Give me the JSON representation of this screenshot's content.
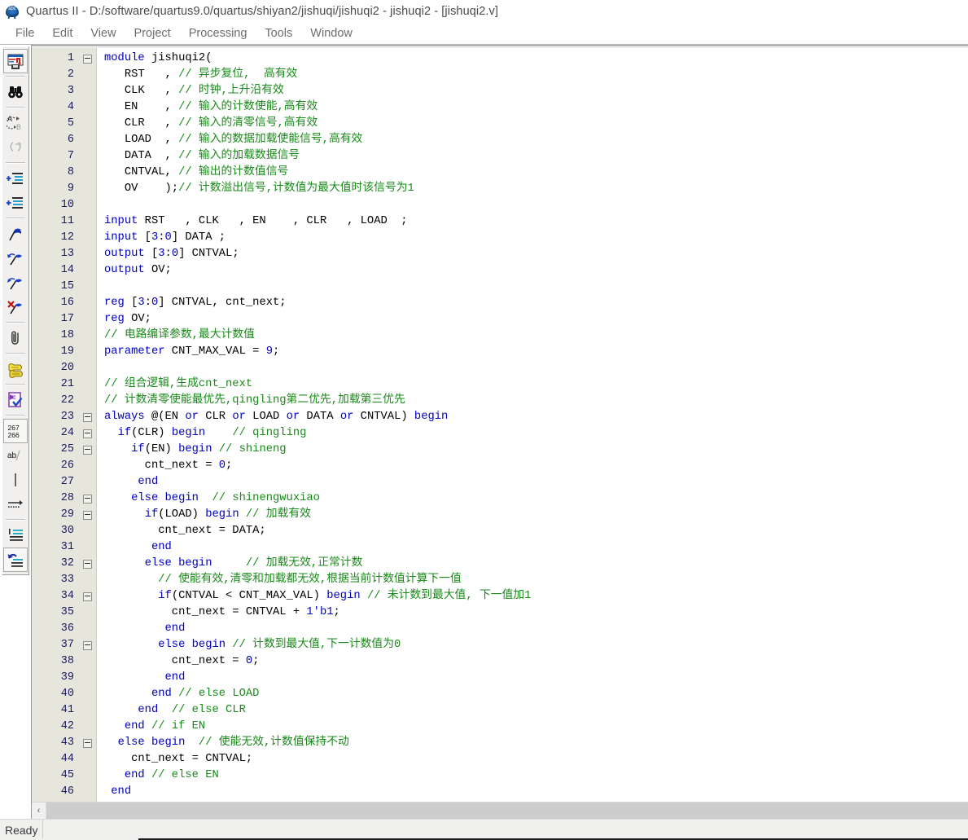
{
  "window": {
    "app_icon": "quartus-abc-icon",
    "title": "Quartus II - D:/software/quartus9.0/quartus/shiyan2/jishuqi/jishuqi2 - jishuqi2 - [jishuqi2.v]"
  },
  "menubar": {
    "items": [
      {
        "label": "File"
      },
      {
        "label": "Edit"
      },
      {
        "label": "View"
      },
      {
        "label": "Project"
      },
      {
        "label": "Processing"
      },
      {
        "label": "Tools"
      },
      {
        "label": "Window"
      }
    ]
  },
  "toolbar": {
    "groups": [
      {
        "buttons": [
          {
            "name": "save-as-icon",
            "selected": true
          }
        ]
      },
      {
        "buttons": [
          {
            "name": "find-binoculars-icon",
            "selected": false
          }
        ]
      },
      {
        "buttons": [
          {
            "name": "replace-a-to-b-icon",
            "selected": false
          },
          {
            "name": "goto-braces-icon",
            "selected": false
          }
        ]
      },
      {
        "buttons": [
          {
            "name": "increase-indent-icon",
            "selected": false
          },
          {
            "name": "decrease-indent-icon",
            "selected": false
          }
        ]
      },
      {
        "buttons": [
          {
            "name": "insert-flag-icon",
            "selected": false
          },
          {
            "name": "next-flag-icon",
            "selected": false
          },
          {
            "name": "previous-flag-icon",
            "selected": false
          },
          {
            "name": "delete-flag-icon",
            "selected": false
          }
        ]
      },
      {
        "buttons": [
          {
            "name": "attach-paperclip-icon",
            "selected": false
          }
        ]
      },
      {
        "buttons": [
          {
            "name": "template-scroll-icon",
            "selected": false
          }
        ]
      },
      {
        "buttons": [
          {
            "name": "check-syntax-icon",
            "selected": false
          }
        ]
      },
      {
        "buttons": [
          {
            "name": "line-numbers-icon",
            "selected": true,
            "label": "267\n266"
          },
          {
            "name": "word-wrap-icon",
            "selected": false,
            "label": "ab/"
          },
          {
            "name": "column-cursor-icon",
            "selected": false
          },
          {
            "name": "show-whitespace-icon",
            "selected": false
          }
        ]
      },
      {
        "buttons": [
          {
            "name": "comment-selection-icon",
            "selected": false
          },
          {
            "name": "uncomment-selection-icon",
            "selected": true
          }
        ]
      }
    ]
  },
  "editor": {
    "file": "jishuqi2.v",
    "first_line": 1,
    "last_line": 46,
    "fold_lines": [
      1,
      23,
      24,
      25,
      28,
      29,
      32,
      34,
      37,
      43
    ],
    "lines": [
      {
        "n": 1,
        "tokens": [
          {
            "t": "kw",
            "s": "module"
          },
          {
            "t": "pln",
            "s": " jishuqi2("
          }
        ]
      },
      {
        "n": 2,
        "tokens": [
          {
            "t": "pln",
            "s": "   RST   , "
          },
          {
            "t": "cmt",
            "s": "// 异步复位,  高有效"
          }
        ]
      },
      {
        "n": 3,
        "tokens": [
          {
            "t": "pln",
            "s": "   CLK   , "
          },
          {
            "t": "cmt",
            "s": "// 时钟,上升沿有效"
          }
        ]
      },
      {
        "n": 4,
        "tokens": [
          {
            "t": "pln",
            "s": "   EN    , "
          },
          {
            "t": "cmt",
            "s": "// 输入的计数使能,高有效"
          }
        ]
      },
      {
        "n": 5,
        "tokens": [
          {
            "t": "pln",
            "s": "   CLR   , "
          },
          {
            "t": "cmt",
            "s": "// 输入的清零信号,高有效"
          }
        ]
      },
      {
        "n": 6,
        "tokens": [
          {
            "t": "pln",
            "s": "   LOAD  , "
          },
          {
            "t": "cmt",
            "s": "// 输入的数据加载使能信号,高有效"
          }
        ]
      },
      {
        "n": 7,
        "tokens": [
          {
            "t": "pln",
            "s": "   DATA  , "
          },
          {
            "t": "cmt",
            "s": "// 输入的加载数据信号"
          }
        ]
      },
      {
        "n": 8,
        "tokens": [
          {
            "t": "pln",
            "s": "   CNTVAL, "
          },
          {
            "t": "cmt",
            "s": "// 输出的计数值信号"
          }
        ]
      },
      {
        "n": 9,
        "tokens": [
          {
            "t": "pln",
            "s": "   OV    );"
          },
          {
            "t": "cmt",
            "s": "// 计数溢出信号,计数值为最大值时该信号为1"
          }
        ]
      },
      {
        "n": 10,
        "tokens": []
      },
      {
        "n": 11,
        "tokens": [
          {
            "t": "kw",
            "s": "input"
          },
          {
            "t": "pln",
            "s": " RST   , CLK   , EN    , CLR   , LOAD  ;"
          }
        ]
      },
      {
        "n": 12,
        "tokens": [
          {
            "t": "kw",
            "s": "input"
          },
          {
            "t": "pln",
            "s": " ["
          },
          {
            "t": "num",
            "s": "3"
          },
          {
            "t": "pln",
            "s": ":"
          },
          {
            "t": "num",
            "s": "0"
          },
          {
            "t": "pln",
            "s": "] DATA ;"
          }
        ]
      },
      {
        "n": 13,
        "tokens": [
          {
            "t": "kw",
            "s": "output"
          },
          {
            "t": "pln",
            "s": " ["
          },
          {
            "t": "num",
            "s": "3"
          },
          {
            "t": "pln",
            "s": ":"
          },
          {
            "t": "num",
            "s": "0"
          },
          {
            "t": "pln",
            "s": "] CNTVAL;"
          }
        ]
      },
      {
        "n": 14,
        "tokens": [
          {
            "t": "kw",
            "s": "output"
          },
          {
            "t": "pln",
            "s": " OV;"
          }
        ]
      },
      {
        "n": 15,
        "tokens": []
      },
      {
        "n": 16,
        "tokens": [
          {
            "t": "kw",
            "s": "reg"
          },
          {
            "t": "pln",
            "s": " ["
          },
          {
            "t": "num",
            "s": "3"
          },
          {
            "t": "pln",
            "s": ":"
          },
          {
            "t": "num",
            "s": "0"
          },
          {
            "t": "pln",
            "s": "] CNTVAL, cnt_next;"
          }
        ]
      },
      {
        "n": 17,
        "tokens": [
          {
            "t": "kw",
            "s": "reg"
          },
          {
            "t": "pln",
            "s": " OV;"
          }
        ]
      },
      {
        "n": 18,
        "tokens": [
          {
            "t": "cmt",
            "s": "// 电路编译参数,最大计数值"
          }
        ]
      },
      {
        "n": 19,
        "tokens": [
          {
            "t": "kw",
            "s": "parameter"
          },
          {
            "t": "pln",
            "s": " CNT_MAX_VAL = "
          },
          {
            "t": "num",
            "s": "9"
          },
          {
            "t": "pln",
            "s": ";"
          }
        ]
      },
      {
        "n": 20,
        "tokens": []
      },
      {
        "n": 21,
        "tokens": [
          {
            "t": "cmt",
            "s": "// 组合逻辑,生成cnt_next"
          }
        ]
      },
      {
        "n": 22,
        "tokens": [
          {
            "t": "cmt",
            "s": "// 计数清零使能最优先,qingling第二优先,加载第三优先"
          }
        ]
      },
      {
        "n": 23,
        "tokens": [
          {
            "t": "kw",
            "s": "always"
          },
          {
            "t": "pln",
            "s": " @(EN "
          },
          {
            "t": "kw",
            "s": "or"
          },
          {
            "t": "pln",
            "s": " CLR "
          },
          {
            "t": "kw",
            "s": "or"
          },
          {
            "t": "pln",
            "s": " LOAD "
          },
          {
            "t": "kw",
            "s": "or"
          },
          {
            "t": "pln",
            "s": " DATA "
          },
          {
            "t": "kw",
            "s": "or"
          },
          {
            "t": "pln",
            "s": " CNTVAL) "
          },
          {
            "t": "kw",
            "s": "begin"
          }
        ]
      },
      {
        "n": 24,
        "tokens": [
          {
            "t": "pln",
            "s": "  "
          },
          {
            "t": "kw",
            "s": "if"
          },
          {
            "t": "pln",
            "s": "(CLR) "
          },
          {
            "t": "kw",
            "s": "begin"
          },
          {
            "t": "pln",
            "s": "    "
          },
          {
            "t": "cmt",
            "s": "// qingling"
          }
        ]
      },
      {
        "n": 25,
        "tokens": [
          {
            "t": "pln",
            "s": "    "
          },
          {
            "t": "kw",
            "s": "if"
          },
          {
            "t": "pln",
            "s": "(EN) "
          },
          {
            "t": "kw",
            "s": "begin"
          },
          {
            "t": "pln",
            "s": " "
          },
          {
            "t": "cmt",
            "s": "// shineng"
          }
        ]
      },
      {
        "n": 26,
        "tokens": [
          {
            "t": "pln",
            "s": "      cnt_next = "
          },
          {
            "t": "num",
            "s": "0"
          },
          {
            "t": "pln",
            "s": ";"
          }
        ]
      },
      {
        "n": 27,
        "tokens": [
          {
            "t": "pln",
            "s": "     "
          },
          {
            "t": "kw",
            "s": "end"
          }
        ]
      },
      {
        "n": 28,
        "tokens": [
          {
            "t": "pln",
            "s": "    "
          },
          {
            "t": "kw",
            "s": "else begin"
          },
          {
            "t": "pln",
            "s": "  "
          },
          {
            "t": "cmt",
            "s": "// shinengwuxiao"
          }
        ]
      },
      {
        "n": 29,
        "tokens": [
          {
            "t": "pln",
            "s": "      "
          },
          {
            "t": "kw",
            "s": "if"
          },
          {
            "t": "pln",
            "s": "(LOAD) "
          },
          {
            "t": "kw",
            "s": "begin"
          },
          {
            "t": "pln",
            "s": " "
          },
          {
            "t": "cmt",
            "s": "// 加载有效"
          }
        ]
      },
      {
        "n": 30,
        "tokens": [
          {
            "t": "pln",
            "s": "        cnt_next = DATA;"
          }
        ]
      },
      {
        "n": 31,
        "tokens": [
          {
            "t": "pln",
            "s": "       "
          },
          {
            "t": "kw",
            "s": "end"
          }
        ]
      },
      {
        "n": 32,
        "tokens": [
          {
            "t": "pln",
            "s": "      "
          },
          {
            "t": "kw",
            "s": "else begin"
          },
          {
            "t": "pln",
            "s": "     "
          },
          {
            "t": "cmt",
            "s": "// 加载无效,正常计数"
          }
        ]
      },
      {
        "n": 33,
        "tokens": [
          {
            "t": "pln",
            "s": "        "
          },
          {
            "t": "cmt",
            "s": "// 使能有效,清零和加载都无效,根据当前计数值计算下一值"
          }
        ]
      },
      {
        "n": 34,
        "tokens": [
          {
            "t": "pln",
            "s": "        "
          },
          {
            "t": "kw",
            "s": "if"
          },
          {
            "t": "pln",
            "s": "(CNTVAL < CNT_MAX_VAL) "
          },
          {
            "t": "kw",
            "s": "begin"
          },
          {
            "t": "pln",
            "s": " "
          },
          {
            "t": "cmt",
            "s": "// 未计数到最大值, 下一值加1"
          }
        ]
      },
      {
        "n": 35,
        "tokens": [
          {
            "t": "pln",
            "s": "          cnt_next = CNTVAL + "
          },
          {
            "t": "num",
            "s": "1'b1"
          },
          {
            "t": "pln",
            "s": ";"
          }
        ]
      },
      {
        "n": 36,
        "tokens": [
          {
            "t": "pln",
            "s": "         "
          },
          {
            "t": "kw",
            "s": "end"
          }
        ]
      },
      {
        "n": 37,
        "tokens": [
          {
            "t": "pln",
            "s": "        "
          },
          {
            "t": "kw",
            "s": "else begin"
          },
          {
            "t": "pln",
            "s": " "
          },
          {
            "t": "cmt",
            "s": "// 计数到最大值,下一计数值为0"
          }
        ]
      },
      {
        "n": 38,
        "tokens": [
          {
            "t": "pln",
            "s": "          cnt_next = "
          },
          {
            "t": "num",
            "s": "0"
          },
          {
            "t": "pln",
            "s": ";"
          }
        ]
      },
      {
        "n": 39,
        "tokens": [
          {
            "t": "pln",
            "s": "         "
          },
          {
            "t": "kw",
            "s": "end"
          }
        ]
      },
      {
        "n": 40,
        "tokens": [
          {
            "t": "pln",
            "s": "       "
          },
          {
            "t": "kw",
            "s": "end"
          },
          {
            "t": "pln",
            "s": " "
          },
          {
            "t": "cmt",
            "s": "// else LOAD"
          }
        ]
      },
      {
        "n": 41,
        "tokens": [
          {
            "t": "pln",
            "s": "     "
          },
          {
            "t": "kw",
            "s": "end"
          },
          {
            "t": "pln",
            "s": "  "
          },
          {
            "t": "cmt",
            "s": "// else CLR"
          }
        ]
      },
      {
        "n": 42,
        "tokens": [
          {
            "t": "pln",
            "s": "   "
          },
          {
            "t": "kw",
            "s": "end"
          },
          {
            "t": "pln",
            "s": " "
          },
          {
            "t": "cmt",
            "s": "// if EN"
          }
        ]
      },
      {
        "n": 43,
        "tokens": [
          {
            "t": "pln",
            "s": "  "
          },
          {
            "t": "kw",
            "s": "else begin"
          },
          {
            "t": "pln",
            "s": "  "
          },
          {
            "t": "cmt",
            "s": "// 使能无效,计数值保持不动"
          }
        ]
      },
      {
        "n": 44,
        "tokens": [
          {
            "t": "pln",
            "s": "    cnt_next = CNTVAL;"
          }
        ]
      },
      {
        "n": 45,
        "tokens": [
          {
            "t": "pln",
            "s": "   "
          },
          {
            "t": "kw",
            "s": "end"
          },
          {
            "t": "pln",
            "s": " "
          },
          {
            "t": "cmt",
            "s": "// else EN"
          }
        ]
      },
      {
        "n": 46,
        "tokens": [
          {
            "t": "pln",
            "s": " "
          },
          {
            "t": "kw",
            "s": "end"
          }
        ]
      }
    ]
  },
  "hscroll": {
    "left_arrow": "‹",
    "thumb_fraction": 1.0
  },
  "statusbar": {
    "message": "Ready"
  },
  "colors": {
    "keyword": "#0000c0",
    "comment": "#1a8a1a",
    "gutter_bg": "#e6e6dc",
    "gutter_fg": "#1a1a5e",
    "editor_bg": "#ffffff",
    "chrome_bg": "#f0f0ef"
  }
}
